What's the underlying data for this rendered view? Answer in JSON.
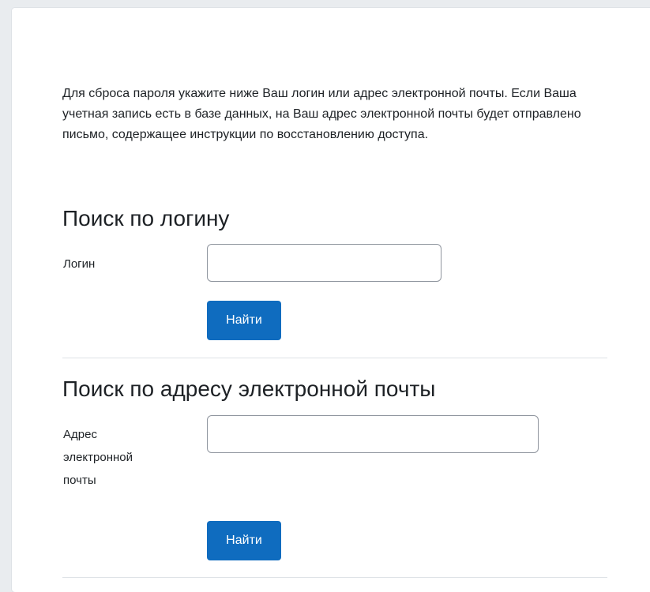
{
  "intro_text": "Для сброса пароля укажите ниже Ваш логин или адрес электронной почты. Если Ваша учетная запись есть в базе данных, на Ваш адрес электронной почты будет отправлено письмо, содержащее инструкции по восстановлению доступа.",
  "login_section": {
    "title": "Поиск по логину",
    "field_label": "Логин",
    "field_value": "",
    "button_label": "Найти"
  },
  "email_section": {
    "title": "Поиск по адресу электронной почты",
    "field_label": "Адрес электронной почты",
    "field_value": "",
    "button_label": "Найти"
  },
  "colors": {
    "primary_button": "#0f6cbf",
    "text": "#1d2125",
    "page_background": "#e9ecef",
    "card_background": "#ffffff"
  }
}
